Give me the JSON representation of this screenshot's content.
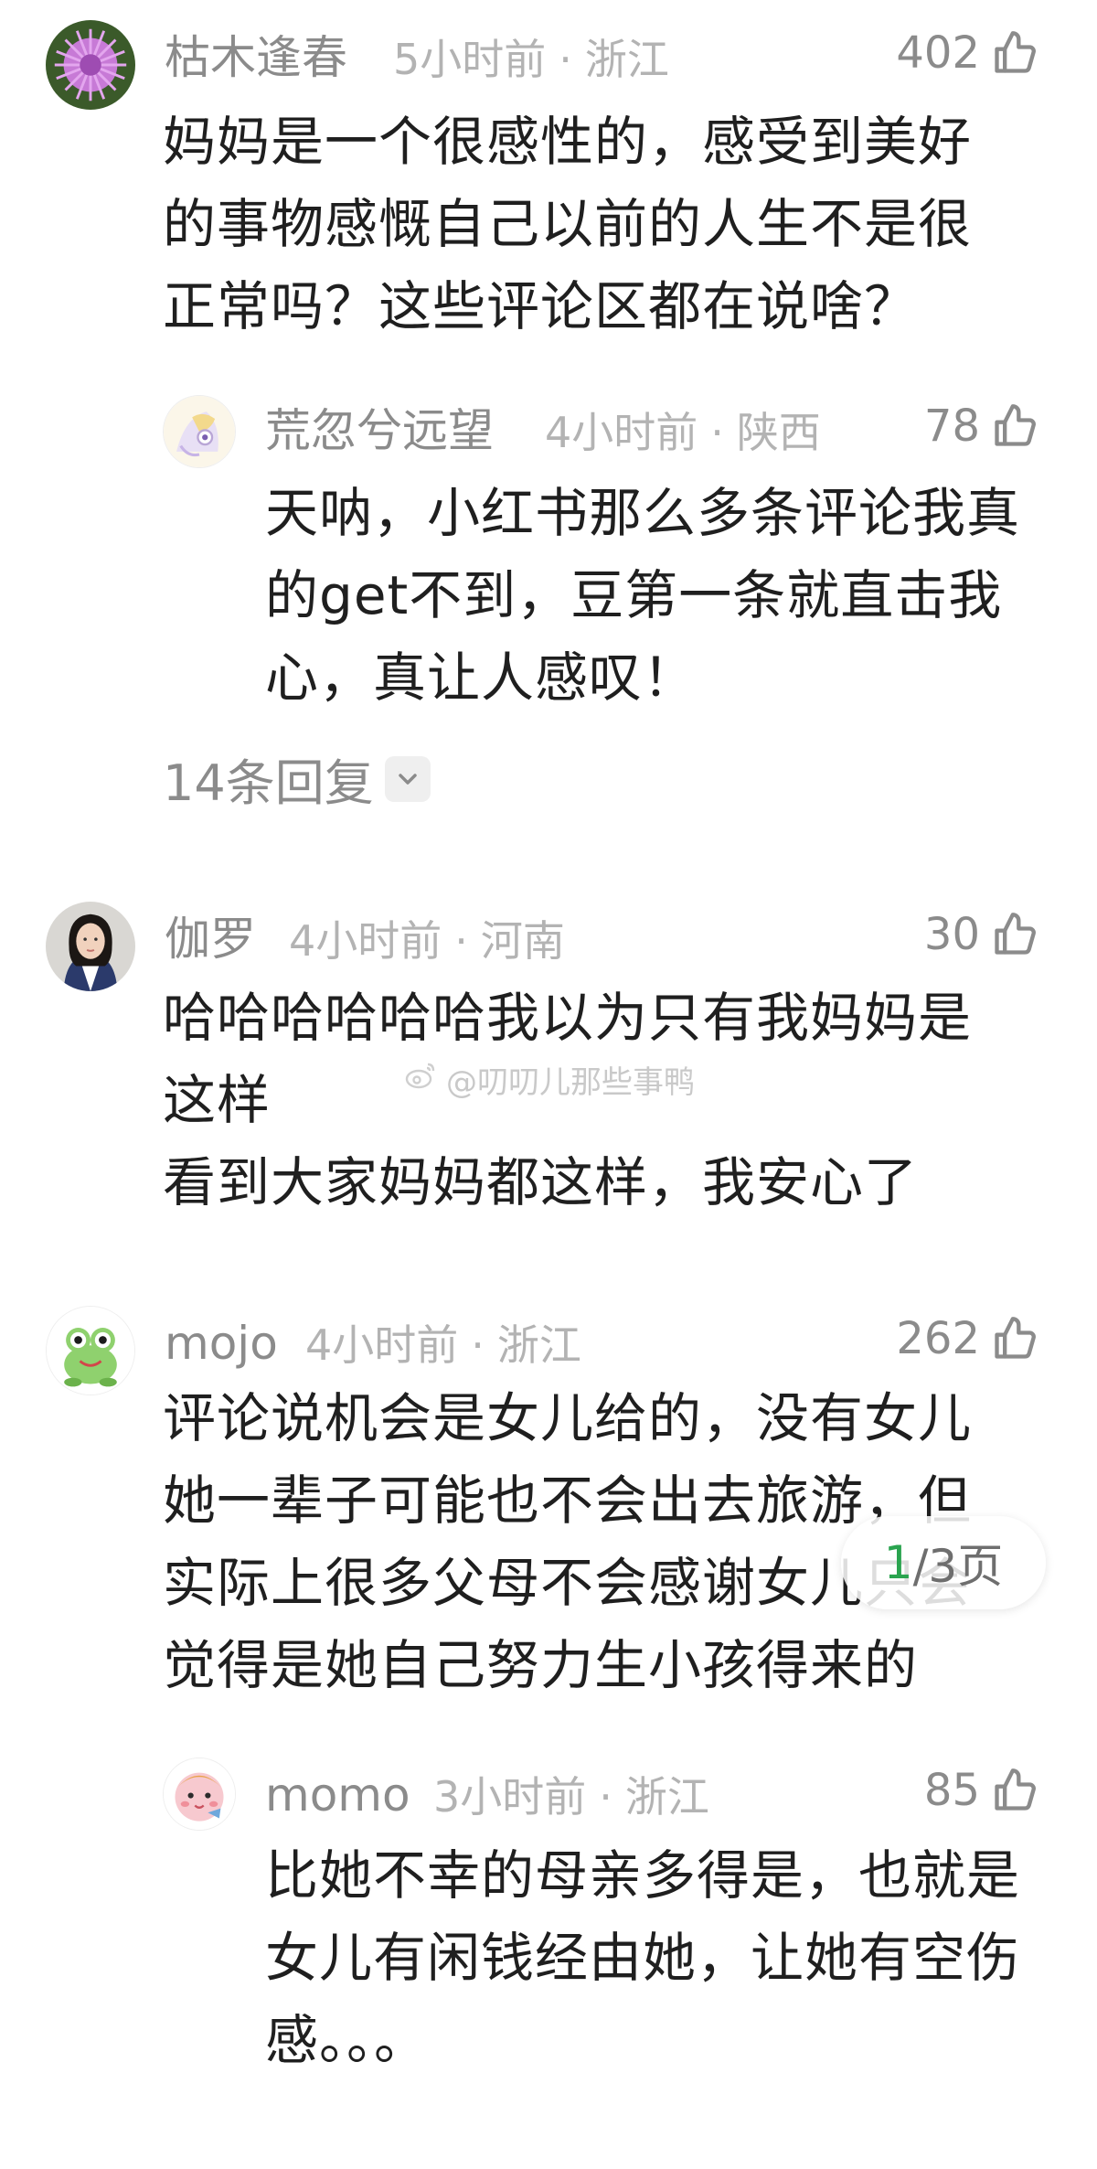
{
  "comments": [
    {
      "name": "枯木逢春",
      "time": "5小时前",
      "location": "浙江",
      "likes": "402",
      "text": "妈妈是一个很感性的，感受到美好\n的事物感慨自己以前的人生不是很\n正常吗？这些评论区都在说啥？"
    },
    {
      "name": "伽罗",
      "time": "4小时前",
      "location": "河南",
      "likes": "30",
      "text": "哈哈哈哈哈哈我以为只有我妈妈是\n这样\n看到大家妈妈都这样，我安心了"
    },
    {
      "name": "mojo",
      "time": "4小时前",
      "location": "浙江",
      "likes": "262",
      "text": "评论说机会是女儿给的，没有女儿\n她一辈子可能也不会出去旅游，但\n实际上很多父母不会感谢女儿只会\n觉得是她自己努力生小孩得来的"
    }
  ],
  "replies": [
    {
      "name": "荒忽兮远望",
      "time": "4小时前",
      "location": "陕西",
      "likes": "78",
      "text": "天呐，小红书那么多条评论我真\n的get不到，豆第一条就直击我\n心，真让人感叹！"
    },
    {
      "name": "momo",
      "time": "3小时前",
      "location": "浙江",
      "likes": "85",
      "text": "比她不幸的母亲多得是，也就是\n女儿有闲钱经由她，让她有空伤\n感。。。"
    }
  ],
  "more_replies_label": "14条回复",
  "watermark": "@叨叨儿那些事鸭",
  "pager": {
    "current": "1",
    "total_label": "/3页"
  },
  "colors": {
    "name": "#8b8b8b",
    "meta": "#b3b3b3",
    "body": "#1f1f1f",
    "pager_current": "#2aa44f"
  },
  "icons": {
    "like": "thumbs-up-icon",
    "expand": "chevron-down-icon",
    "watermark": "weibo-logo-icon"
  }
}
